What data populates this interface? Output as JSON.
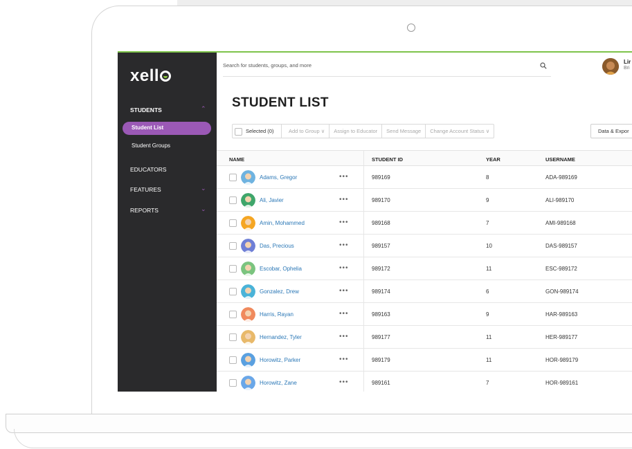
{
  "app": {
    "logo": "xell"
  },
  "sidebar": {
    "students_heading": "STUDENTS",
    "items": [
      {
        "label": "Student List"
      },
      {
        "label": "Student Groups"
      }
    ],
    "sections": [
      {
        "label": "EDUCATORS"
      },
      {
        "label": "FEATURES"
      },
      {
        "label": "REPORTS"
      }
    ]
  },
  "topbar": {
    "search_placeholder": "Search for students, groups, and more",
    "user_name": "Lir",
    "user_sub": "Bri"
  },
  "page": {
    "title": "STUDENT LIST"
  },
  "toolbar": {
    "selected": "Selected (0)",
    "add_to_group": "Add to Group",
    "assign_to_educator": "Assign to Educator",
    "send_message": "Send Message",
    "change_account_status": "Change Account Status",
    "data_export": "Data & Expor"
  },
  "table": {
    "columns": {
      "name": "NAME",
      "student_id": "STUDENT ID",
      "year": "YEAR",
      "username": "USERNAME"
    },
    "rows": [
      {
        "name": "Adams, Gregor",
        "id": "989169",
        "year": "8",
        "username": "ADA-989169",
        "avatar_color": "#6fb3e0"
      },
      {
        "name": "Ali, Javier",
        "id": "989170",
        "year": "9",
        "username": "ALI-989170",
        "avatar_color": "#3fa66b"
      },
      {
        "name": "Amin, Mohammed",
        "id": "989168",
        "year": "7",
        "username": "AMI-989168",
        "avatar_color": "#f5a623"
      },
      {
        "name": "Das, Precious",
        "id": "989157",
        "year": "10",
        "username": "DAS-989157",
        "avatar_color": "#6f7fd6"
      },
      {
        "name": "Escobar, Ophelia",
        "id": "989172",
        "year": "11",
        "username": "ESC-989172",
        "avatar_color": "#7bc47f"
      },
      {
        "name": "Gonzalez, Drew",
        "id": "989174",
        "year": "6",
        "username": "GON-989174",
        "avatar_color": "#4ab3d8"
      },
      {
        "name": "Harris, Rayan",
        "id": "989163",
        "year": "9",
        "username": "HAR-989163",
        "avatar_color": "#f08a5d"
      },
      {
        "name": "Hernandez, Tyler",
        "id": "989177",
        "year": "11",
        "username": "HER-989177",
        "avatar_color": "#e8b96a"
      },
      {
        "name": "Horowitz, Parker",
        "id": "989179",
        "year": "11",
        "username": "HOR-989179",
        "avatar_color": "#5aa0e0"
      },
      {
        "name": "Horowitz, Zane",
        "id": "989161",
        "year": "7",
        "username": "HOR-989161",
        "avatar_color": "#6aa7e8"
      }
    ]
  },
  "colors": {
    "accent": "#9b59b6",
    "sidebar": "#2a2a2c",
    "link": "#2a77b6",
    "brand_green": "#7dc34a"
  }
}
